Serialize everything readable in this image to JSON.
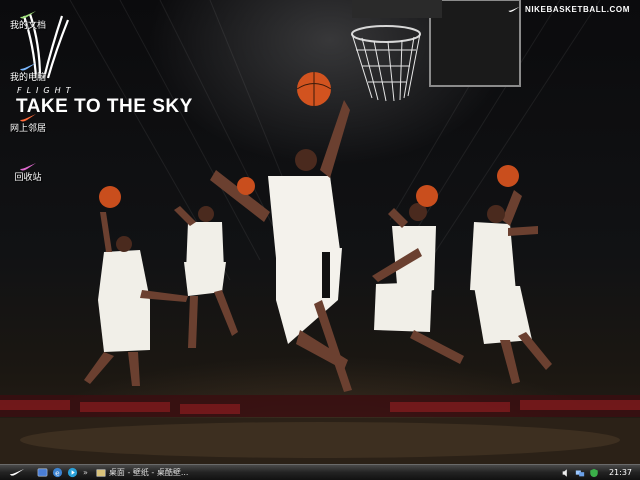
{
  "desktop": {
    "icons": [
      {
        "label": "我的文档",
        "icon": "nike-swoosh-icon",
        "color": "#9ee07a"
      },
      {
        "label": "我的电脑",
        "icon": "nike-swoosh-icon",
        "color": "#7ab8ff"
      },
      {
        "label": "网上邻居",
        "icon": "nike-swoosh-icon",
        "color": "#ff6a3a"
      },
      {
        "label": "回收站",
        "icon": "nike-swoosh-icon",
        "color": "#e06ad0"
      }
    ]
  },
  "wallpaper": {
    "flight": "FLIGHT",
    "tagline": "TAKE TO THE SKY",
    "brand": "NIKEBASKETBALL.COM"
  },
  "taskbar": {
    "start_icon": "nike-swoosh-icon",
    "quick_launch": [
      "show-desktop-icon",
      "ie-icon",
      "media-icon"
    ],
    "overflow": "»",
    "task_label": "桌面 - 壁纸 - 桌酷壁...",
    "tray_icons": [
      "speaker-icon",
      "network-icon",
      "antivirus-icon"
    ],
    "clock": "21:37"
  },
  "colors": {
    "swoosh": "#ffffff",
    "taskbar": "#222222",
    "ball": "#d2531f"
  }
}
